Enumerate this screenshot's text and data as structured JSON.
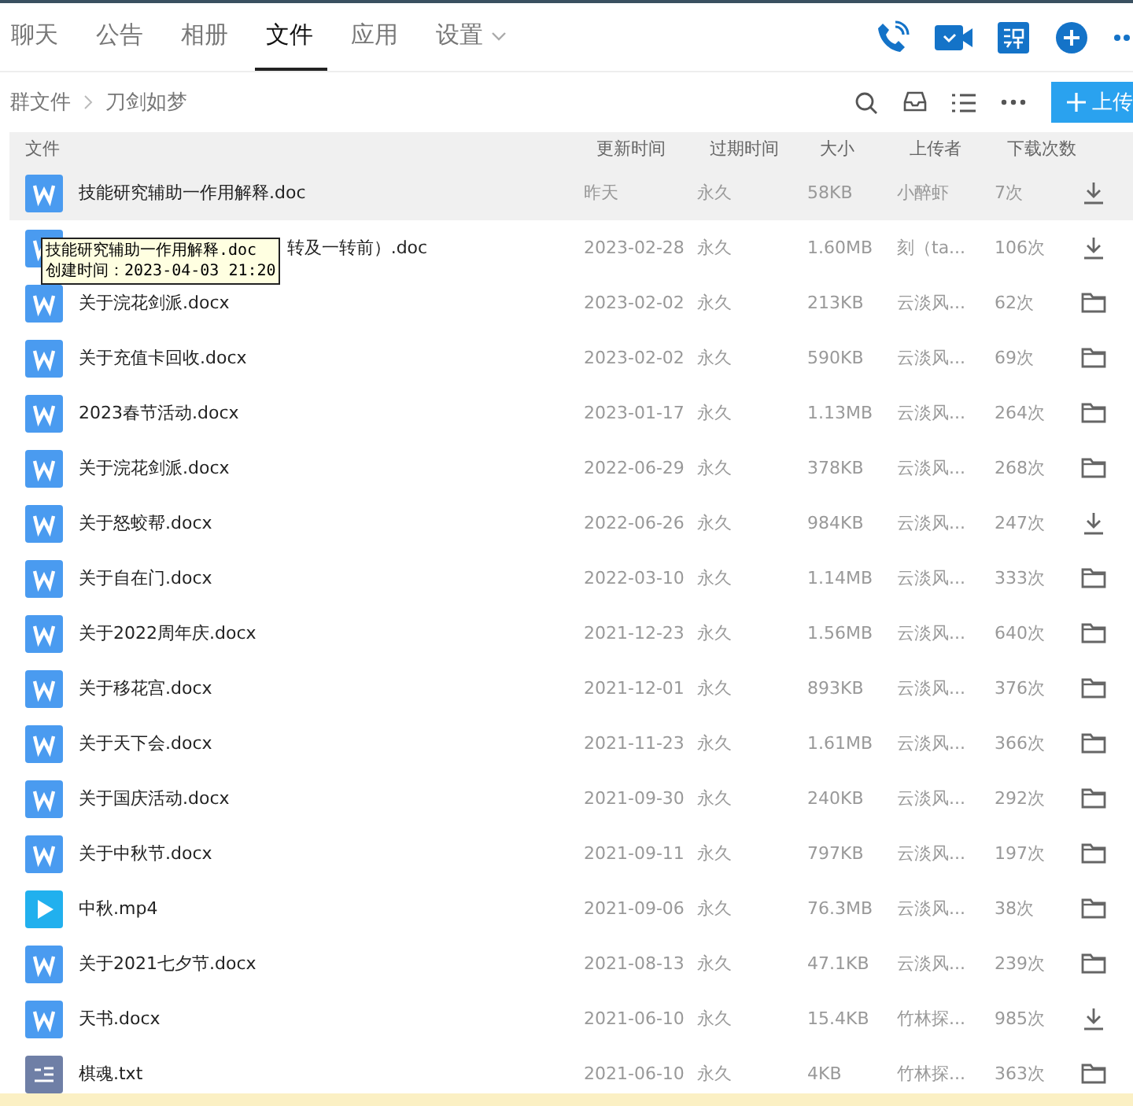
{
  "tabs": [
    {
      "label": "聊天",
      "selected": false
    },
    {
      "label": "公告",
      "selected": false
    },
    {
      "label": "相册",
      "selected": false
    },
    {
      "label": "文件",
      "selected": true
    },
    {
      "label": "应用",
      "selected": false
    },
    {
      "label": "设置",
      "selected": false,
      "dropdown": true
    }
  ],
  "breadcrumb": [
    "群文件",
    "刀剑如梦"
  ],
  "upload_button": "上传",
  "columns": [
    "文件",
    "更新时间",
    "过期时间",
    "大小",
    "上传者",
    "下载次数"
  ],
  "rows": [
    {
      "kind": "word",
      "name": "技能研究辅助一作用解释.doc",
      "updated": "昨天",
      "expires": "永久",
      "size": "58KB",
      "uploader": "小醉虾",
      "downloads": "7次",
      "action": {
        "kind": "download"
      },
      "selected": true
    },
    {
      "kind": "word",
      "name": "转及一转前）.doc",
      "updated": "2023-02-28",
      "expires": "永久",
      "size": "1.60MB",
      "uploader": "刻（ta...",
      "downloads": "106次",
      "action": {
        "kind": "download"
      },
      "selected": false,
      "tooltip": [
        "技能研究辅助一作用解释.doc",
        "创建时间：2023-04-03 21:20"
      ]
    },
    {
      "kind": "word",
      "name": "关于浣花剑派.docx",
      "updated": "2023-02-02",
      "expires": "永久",
      "size": "213KB",
      "uploader": "云淡风...",
      "downloads": "62次",
      "action": {
        "kind": "folder"
      },
      "selected": false
    },
    {
      "kind": "word",
      "name": "关于充值卡回收.docx",
      "updated": "2023-02-02",
      "expires": "永久",
      "size": "590KB",
      "uploader": "云淡风...",
      "downloads": "69次",
      "action": {
        "kind": "folder"
      },
      "selected": false
    },
    {
      "kind": "word",
      "name": "2023春节活动.docx",
      "updated": "2023-01-17",
      "expires": "永久",
      "size": "1.13MB",
      "uploader": "云淡风...",
      "downloads": "264次",
      "action": {
        "kind": "folder"
      },
      "selected": false
    },
    {
      "kind": "word",
      "name": "关于浣花剑派.docx",
      "updated": "2022-06-29",
      "expires": "永久",
      "size": "378KB",
      "uploader": "云淡风...",
      "downloads": "268次",
      "action": {
        "kind": "folder"
      },
      "selected": false
    },
    {
      "kind": "word",
      "name": "关于怒蛟帮.docx",
      "updated": "2022-06-26",
      "expires": "永久",
      "size": "984KB",
      "uploader": "云淡风...",
      "downloads": "247次",
      "action": {
        "kind": "download"
      },
      "selected": false
    },
    {
      "kind": "word",
      "name": "关于自在门.docx",
      "updated": "2022-03-10",
      "expires": "永久",
      "size": "1.14MB",
      "uploader": "云淡风...",
      "downloads": "333次",
      "action": {
        "kind": "folder"
      },
      "selected": false
    },
    {
      "kind": "word",
      "name": "关于2022周年庆.docx",
      "updated": "2021-12-23",
      "expires": "永久",
      "size": "1.56MB",
      "uploader": "云淡风...",
      "downloads": "640次",
      "action": {
        "kind": "folder"
      },
      "selected": false
    },
    {
      "kind": "word",
      "name": "关于移花宫.docx",
      "updated": "2021-12-01",
      "expires": "永久",
      "size": "893KB",
      "uploader": "云淡风...",
      "downloads": "376次",
      "action": {
        "kind": "folder"
      },
      "selected": false
    },
    {
      "kind": "word",
      "name": "关于天下会.docx",
      "updated": "2021-11-23",
      "expires": "永久",
      "size": "1.61MB",
      "uploader": "云淡风...",
      "downloads": "366次",
      "action": {
        "kind": "folder"
      },
      "selected": false
    },
    {
      "kind": "word",
      "name": "关于国庆活动.docx",
      "updated": "2021-09-30",
      "expires": "永久",
      "size": "240KB",
      "uploader": "云淡风...",
      "downloads": "292次",
      "action": {
        "kind": "folder"
      },
      "selected": false
    },
    {
      "kind": "word",
      "name": "关于中秋节.docx",
      "updated": "2021-09-11",
      "expires": "永久",
      "size": "797KB",
      "uploader": "云淡风...",
      "downloads": "197次",
      "action": {
        "kind": "folder"
      },
      "selected": false
    },
    {
      "kind": "video",
      "name": "中秋.mp4",
      "updated": "2021-09-06",
      "expires": "永久",
      "size": "76.3MB",
      "uploader": "云淡风...",
      "downloads": "38次",
      "action": {
        "kind": "folder"
      },
      "selected": false
    },
    {
      "kind": "word",
      "name": "关于2021七夕节.docx",
      "updated": "2021-08-13",
      "expires": "永久",
      "size": "47.1KB",
      "uploader": "云淡风...",
      "downloads": "239次",
      "action": {
        "kind": "folder"
      },
      "selected": false
    },
    {
      "kind": "word",
      "name": "天书.docx",
      "updated": "2021-06-10",
      "expires": "永久",
      "size": "15.4KB",
      "uploader": "竹林探...",
      "downloads": "985次",
      "action": {
        "kind": "download"
      },
      "selected": false
    },
    {
      "kind": "text",
      "name": "棋魂.txt",
      "updated": "2021-06-10",
      "expires": "永久",
      "size": "4KB",
      "uploader": "竹林探...",
      "downloads": "363次",
      "action": {
        "kind": "folder"
      },
      "selected": false
    }
  ]
}
